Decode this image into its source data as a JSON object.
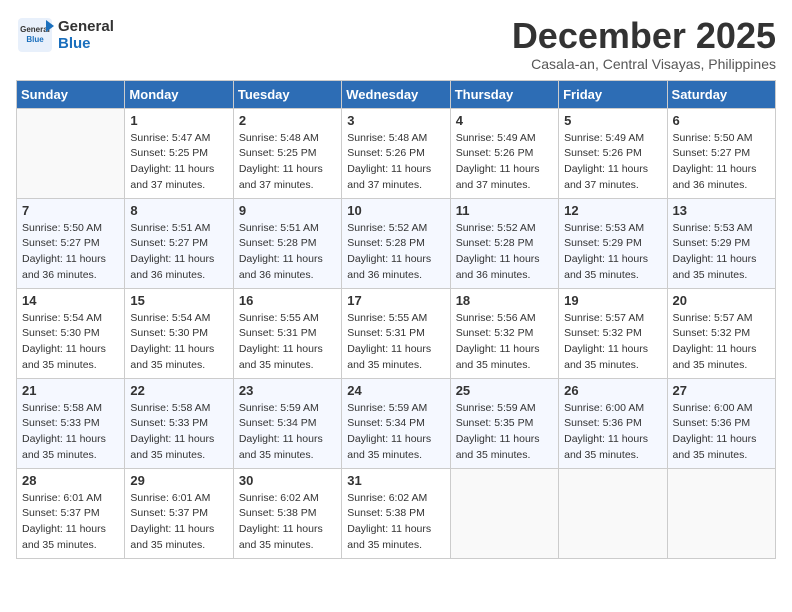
{
  "header": {
    "logo_general": "General",
    "logo_blue": "Blue",
    "month_title": "December 2025",
    "location": "Casala-an, Central Visayas, Philippines"
  },
  "weekdays": [
    "Sunday",
    "Monday",
    "Tuesday",
    "Wednesday",
    "Thursday",
    "Friday",
    "Saturday"
  ],
  "weeks": [
    [
      {
        "day": "",
        "sunrise": "",
        "sunset": "",
        "daylight": ""
      },
      {
        "day": "1",
        "sunrise": "Sunrise: 5:47 AM",
        "sunset": "Sunset: 5:25 PM",
        "daylight": "Daylight: 11 hours and 37 minutes."
      },
      {
        "day": "2",
        "sunrise": "Sunrise: 5:48 AM",
        "sunset": "Sunset: 5:25 PM",
        "daylight": "Daylight: 11 hours and 37 minutes."
      },
      {
        "day": "3",
        "sunrise": "Sunrise: 5:48 AM",
        "sunset": "Sunset: 5:26 PM",
        "daylight": "Daylight: 11 hours and 37 minutes."
      },
      {
        "day": "4",
        "sunrise": "Sunrise: 5:49 AM",
        "sunset": "Sunset: 5:26 PM",
        "daylight": "Daylight: 11 hours and 37 minutes."
      },
      {
        "day": "5",
        "sunrise": "Sunrise: 5:49 AM",
        "sunset": "Sunset: 5:26 PM",
        "daylight": "Daylight: 11 hours and 37 minutes."
      },
      {
        "day": "6",
        "sunrise": "Sunrise: 5:50 AM",
        "sunset": "Sunset: 5:27 PM",
        "daylight": "Daylight: 11 hours and 36 minutes."
      }
    ],
    [
      {
        "day": "7",
        "sunrise": "Sunrise: 5:50 AM",
        "sunset": "Sunset: 5:27 PM",
        "daylight": "Daylight: 11 hours and 36 minutes."
      },
      {
        "day": "8",
        "sunrise": "Sunrise: 5:51 AM",
        "sunset": "Sunset: 5:27 PM",
        "daylight": "Daylight: 11 hours and 36 minutes."
      },
      {
        "day": "9",
        "sunrise": "Sunrise: 5:51 AM",
        "sunset": "Sunset: 5:28 PM",
        "daylight": "Daylight: 11 hours and 36 minutes."
      },
      {
        "day": "10",
        "sunrise": "Sunrise: 5:52 AM",
        "sunset": "Sunset: 5:28 PM",
        "daylight": "Daylight: 11 hours and 36 minutes."
      },
      {
        "day": "11",
        "sunrise": "Sunrise: 5:52 AM",
        "sunset": "Sunset: 5:28 PM",
        "daylight": "Daylight: 11 hours and 36 minutes."
      },
      {
        "day": "12",
        "sunrise": "Sunrise: 5:53 AM",
        "sunset": "Sunset: 5:29 PM",
        "daylight": "Daylight: 11 hours and 35 minutes."
      },
      {
        "day": "13",
        "sunrise": "Sunrise: 5:53 AM",
        "sunset": "Sunset: 5:29 PM",
        "daylight": "Daylight: 11 hours and 35 minutes."
      }
    ],
    [
      {
        "day": "14",
        "sunrise": "Sunrise: 5:54 AM",
        "sunset": "Sunset: 5:30 PM",
        "daylight": "Daylight: 11 hours and 35 minutes."
      },
      {
        "day": "15",
        "sunrise": "Sunrise: 5:54 AM",
        "sunset": "Sunset: 5:30 PM",
        "daylight": "Daylight: 11 hours and 35 minutes."
      },
      {
        "day": "16",
        "sunrise": "Sunrise: 5:55 AM",
        "sunset": "Sunset: 5:31 PM",
        "daylight": "Daylight: 11 hours and 35 minutes."
      },
      {
        "day": "17",
        "sunrise": "Sunrise: 5:55 AM",
        "sunset": "Sunset: 5:31 PM",
        "daylight": "Daylight: 11 hours and 35 minutes."
      },
      {
        "day": "18",
        "sunrise": "Sunrise: 5:56 AM",
        "sunset": "Sunset: 5:32 PM",
        "daylight": "Daylight: 11 hours and 35 minutes."
      },
      {
        "day": "19",
        "sunrise": "Sunrise: 5:57 AM",
        "sunset": "Sunset: 5:32 PM",
        "daylight": "Daylight: 11 hours and 35 minutes."
      },
      {
        "day": "20",
        "sunrise": "Sunrise: 5:57 AM",
        "sunset": "Sunset: 5:32 PM",
        "daylight": "Daylight: 11 hours and 35 minutes."
      }
    ],
    [
      {
        "day": "21",
        "sunrise": "Sunrise: 5:58 AM",
        "sunset": "Sunset: 5:33 PM",
        "daylight": "Daylight: 11 hours and 35 minutes."
      },
      {
        "day": "22",
        "sunrise": "Sunrise: 5:58 AM",
        "sunset": "Sunset: 5:33 PM",
        "daylight": "Daylight: 11 hours and 35 minutes."
      },
      {
        "day": "23",
        "sunrise": "Sunrise: 5:59 AM",
        "sunset": "Sunset: 5:34 PM",
        "daylight": "Daylight: 11 hours and 35 minutes."
      },
      {
        "day": "24",
        "sunrise": "Sunrise: 5:59 AM",
        "sunset": "Sunset: 5:34 PM",
        "daylight": "Daylight: 11 hours and 35 minutes."
      },
      {
        "day": "25",
        "sunrise": "Sunrise: 5:59 AM",
        "sunset": "Sunset: 5:35 PM",
        "daylight": "Daylight: 11 hours and 35 minutes."
      },
      {
        "day": "26",
        "sunrise": "Sunrise: 6:00 AM",
        "sunset": "Sunset: 5:36 PM",
        "daylight": "Daylight: 11 hours and 35 minutes."
      },
      {
        "day": "27",
        "sunrise": "Sunrise: 6:00 AM",
        "sunset": "Sunset: 5:36 PM",
        "daylight": "Daylight: 11 hours and 35 minutes."
      }
    ],
    [
      {
        "day": "28",
        "sunrise": "Sunrise: 6:01 AM",
        "sunset": "Sunset: 5:37 PM",
        "daylight": "Daylight: 11 hours and 35 minutes."
      },
      {
        "day": "29",
        "sunrise": "Sunrise: 6:01 AM",
        "sunset": "Sunset: 5:37 PM",
        "daylight": "Daylight: 11 hours and 35 minutes."
      },
      {
        "day": "30",
        "sunrise": "Sunrise: 6:02 AM",
        "sunset": "Sunset: 5:38 PM",
        "daylight": "Daylight: 11 hours and 35 minutes."
      },
      {
        "day": "31",
        "sunrise": "Sunrise: 6:02 AM",
        "sunset": "Sunset: 5:38 PM",
        "daylight": "Daylight: 11 hours and 35 minutes."
      },
      {
        "day": "",
        "sunrise": "",
        "sunset": "",
        "daylight": ""
      },
      {
        "day": "",
        "sunrise": "",
        "sunset": "",
        "daylight": ""
      },
      {
        "day": "",
        "sunrise": "",
        "sunset": "",
        "daylight": ""
      }
    ]
  ]
}
